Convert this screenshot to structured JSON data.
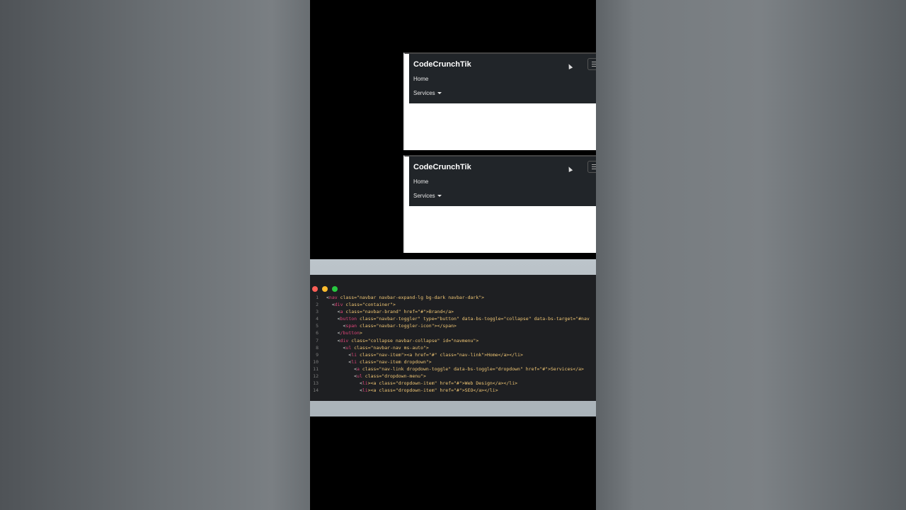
{
  "previews": [
    {
      "brand": "CodeCrunchTik",
      "home": "Home",
      "services": "Services"
    },
    {
      "brand": "CodeCrunchTik",
      "home": "Home",
      "services": "Services"
    }
  ],
  "editor": {
    "window_buttons": [
      "close",
      "minimize",
      "maximize"
    ],
    "lines": [
      {
        "n": "1",
        "indent": "",
        "tag": "nav",
        "attrs": "class=\"navbar navbar-expand-lg bg-dark navbar-dark\">"
      },
      {
        "n": "2",
        "indent": "  ",
        "tag": "div",
        "attrs": "class=\"container\">"
      },
      {
        "n": "3",
        "indent": "    ",
        "tag": "a",
        "attrs": "class=\"navbar-brand\" href=\"#\">Brand</a>"
      },
      {
        "n": "4",
        "indent": "    ",
        "tag": "button",
        "attrs": "class=\"navbar-toggler\" type=\"button\" data-bs-toggle=\"collapse\" data-bs-target=\"#nav"
      },
      {
        "n": "5",
        "indent": "      ",
        "tag": "span",
        "attrs": "class=\"navbar-toggler-icon\"></span>"
      },
      {
        "n": "6",
        "indent": "    ",
        "tag": "/button",
        "attrs": ">"
      },
      {
        "n": "7",
        "indent": "    ",
        "tag": "div",
        "attrs": "class=\"collapse navbar-collapse\" id=\"navmenu\">"
      },
      {
        "n": "8",
        "indent": "      ",
        "tag": "ul",
        "attrs": "class=\"navbar-nav ms-auto\">"
      },
      {
        "n": "9",
        "indent": "        ",
        "tag": "li",
        "attrs": "class=\"nav-item\"><a href=\"#\" class=\"nav-link\">Home</a></li>"
      },
      {
        "n": "10",
        "indent": "        ",
        "tag": "li",
        "attrs": "class=\"nav-item dropdown\">"
      },
      {
        "n": "11",
        "indent": "          ",
        "tag": "a",
        "attrs": "class=\"nav-link dropdown-toggle\" data-bs-toggle=\"dropdown\" href=\"#\">Services</a>"
      },
      {
        "n": "12",
        "indent": "          ",
        "tag": "ul",
        "attrs": "class=\"dropdown-menu\">"
      },
      {
        "n": "13",
        "indent": "            ",
        "tag": "li",
        "attrs": "><a class=\"dropdown-item\" href=\"#\">Web Design</a></li>"
      },
      {
        "n": "14",
        "indent": "            ",
        "tag": "li",
        "attrs": "><a class=\"dropdown-item\" href=\"#\">SEO</a></li>"
      }
    ]
  }
}
